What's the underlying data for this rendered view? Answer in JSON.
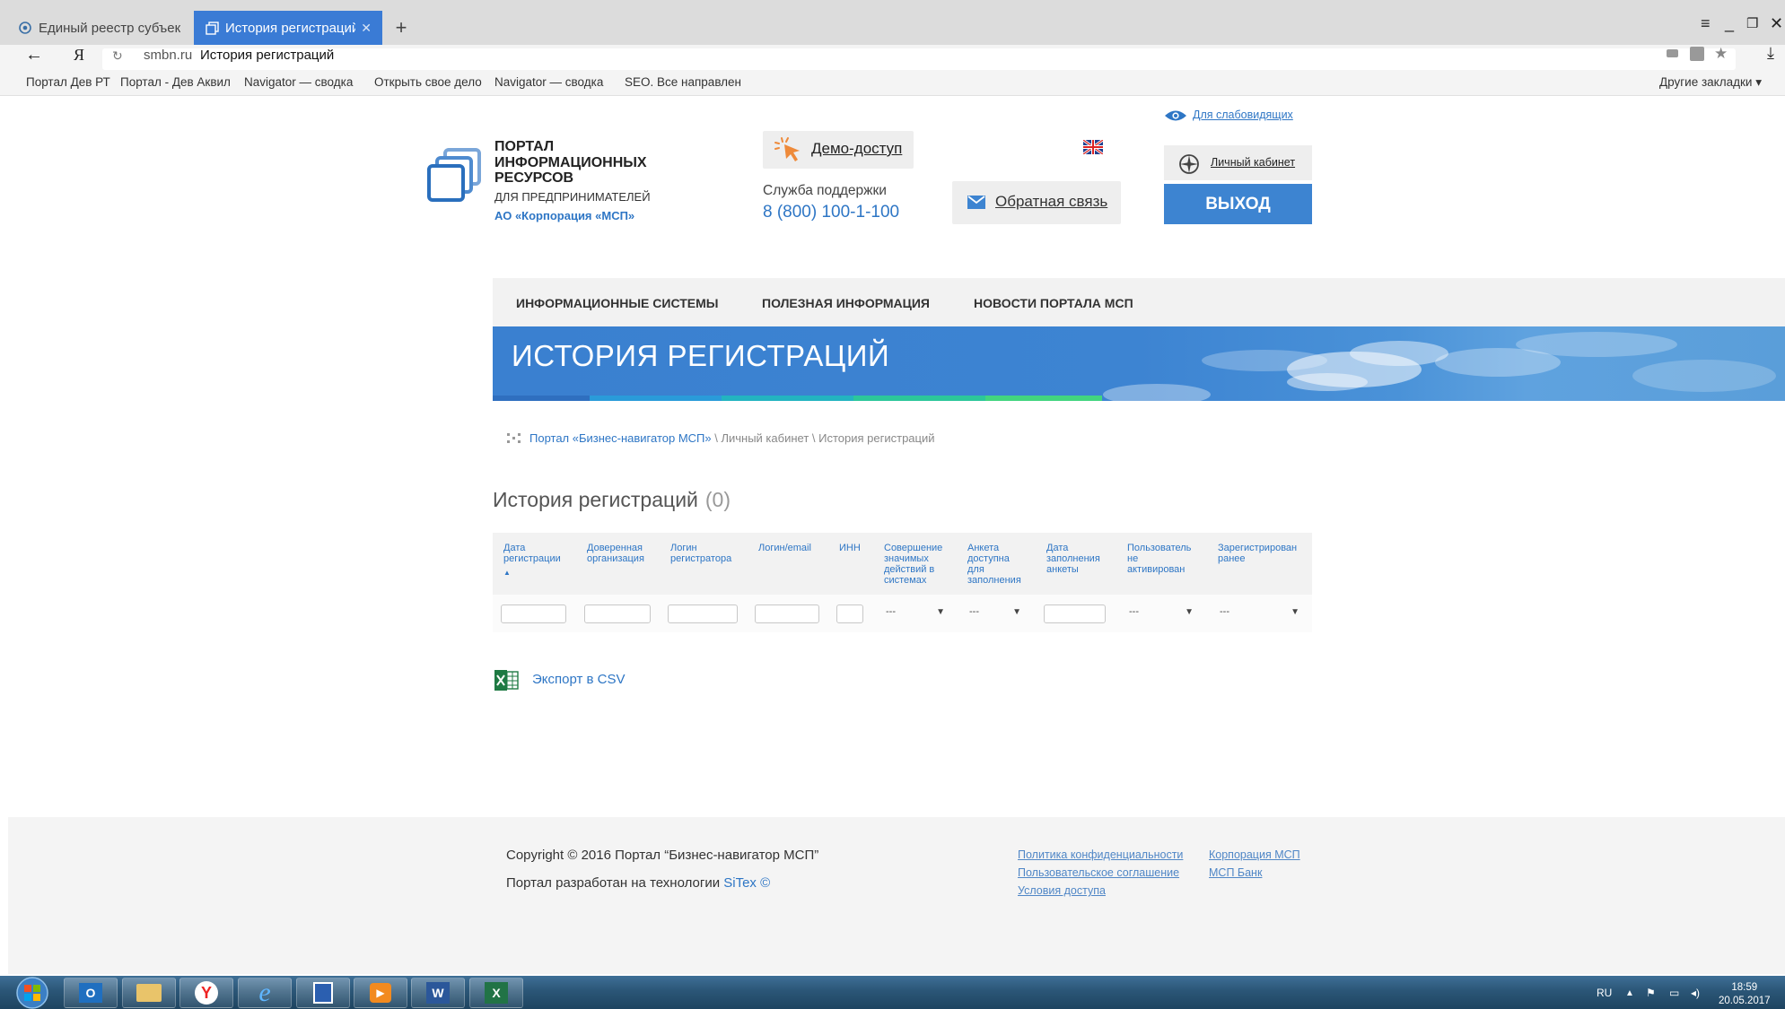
{
  "browser": {
    "tabs": [
      {
        "title": "Единый реестр субъектов м",
        "active": false
      },
      {
        "title": "История регистраций",
        "active": true
      }
    ],
    "new_tab": "+",
    "address": {
      "domain": "smbn.ru",
      "title": "История регистраций"
    },
    "bookmarks": [
      "Портал Дев РТ",
      "Портал - Дев Аквил",
      "Navigator — сводка",
      "Открыть свое дело",
      "Navigator — сводка",
      "SEO. Все направления"
    ],
    "other_bookmarks": "Другие закладки"
  },
  "header": {
    "logo_title": [
      "ПОРТАЛ",
      "ИНФОРМАЦИОННЫХ",
      "РЕСУРСОВ"
    ],
    "logo_sub": "ДЛЯ ПРЕДПРИНИМАТЕЛЕЙ",
    "logo_corp": "АО «Корпорация «МСП»",
    "demo": "Демо-доступ",
    "support_label": "Служба поддержки",
    "support_phone": "8 (800) 100-1-100",
    "feedback": "Обратная связь",
    "low_vision": "Для слабовидящих",
    "cabinet": "Личный кабинет",
    "logout": "ВЫХОД"
  },
  "nav": [
    "ИНФОРМАЦИОННЫЕ СИСТЕМЫ",
    "ПОЛЕЗНАЯ ИНФОРМАЦИЯ",
    "НОВОСТИ ПОРТАЛА МСП"
  ],
  "banner_title": "ИСТОРИЯ РЕГИСТРАЦИЙ",
  "breadcrumb": {
    "home": "Портал «Бизнес-навигатор МСП»",
    "sep1": " \\ ",
    "cabinet": "Личный кабинет",
    "sep2": " \\ ",
    "current": "История регистраций"
  },
  "page": {
    "title": "История регистраций",
    "count": "(0)"
  },
  "table": {
    "columns": [
      [
        "Дата",
        "регистрации"
      ],
      [
        "Доверенная",
        "организация"
      ],
      [
        "Логин",
        "регистратора"
      ],
      [
        "Логин/email"
      ],
      [
        "ИНН"
      ],
      [
        "Совершение",
        "значимых",
        "действий в",
        "системах"
      ],
      [
        "Анкета",
        "доступна",
        "для",
        "заполнения"
      ],
      [
        "Дата",
        "заполнения",
        "анкеты"
      ],
      [
        "Пользователь",
        "не",
        "активирован"
      ],
      [
        "Зарегистрирован",
        "ранее"
      ]
    ],
    "sort_indicator": "▲",
    "select_placeholder": "---",
    "select_arrow": "▼"
  },
  "export": "Экспорт в CSV",
  "footer": {
    "copyright": "Copyright © 2016 Портал “Бизнес-навигатор МСП”",
    "dev_text": "Портал разработан на технологии ",
    "dev_link": "SiTex ©",
    "links_col1": [
      "Политика конфиденциальности",
      "Пользовательское соглашение",
      "Условия доступа"
    ],
    "links_col2": [
      "Корпорация МСП",
      "МСП Банк"
    ]
  },
  "taskbar": {
    "lang": "RU",
    "time": "18:59",
    "date": "20.05.2017"
  },
  "colors": {
    "brand_blue": "#2e76c5",
    "button_blue": "#3d84d1",
    "tab_active": "#3a7bd5"
  },
  "icons": [
    "shield-tab-icon",
    "pages-tab-icon",
    "back-arrow-icon",
    "yandex-icon",
    "reload-icon",
    "star-icon",
    "download-icon",
    "menu-icon",
    "eye-icon",
    "compass-icon",
    "mail-icon",
    "cursor-click-icon",
    "uk-flag-icon",
    "excel-icon",
    "windows-start-icon"
  ]
}
